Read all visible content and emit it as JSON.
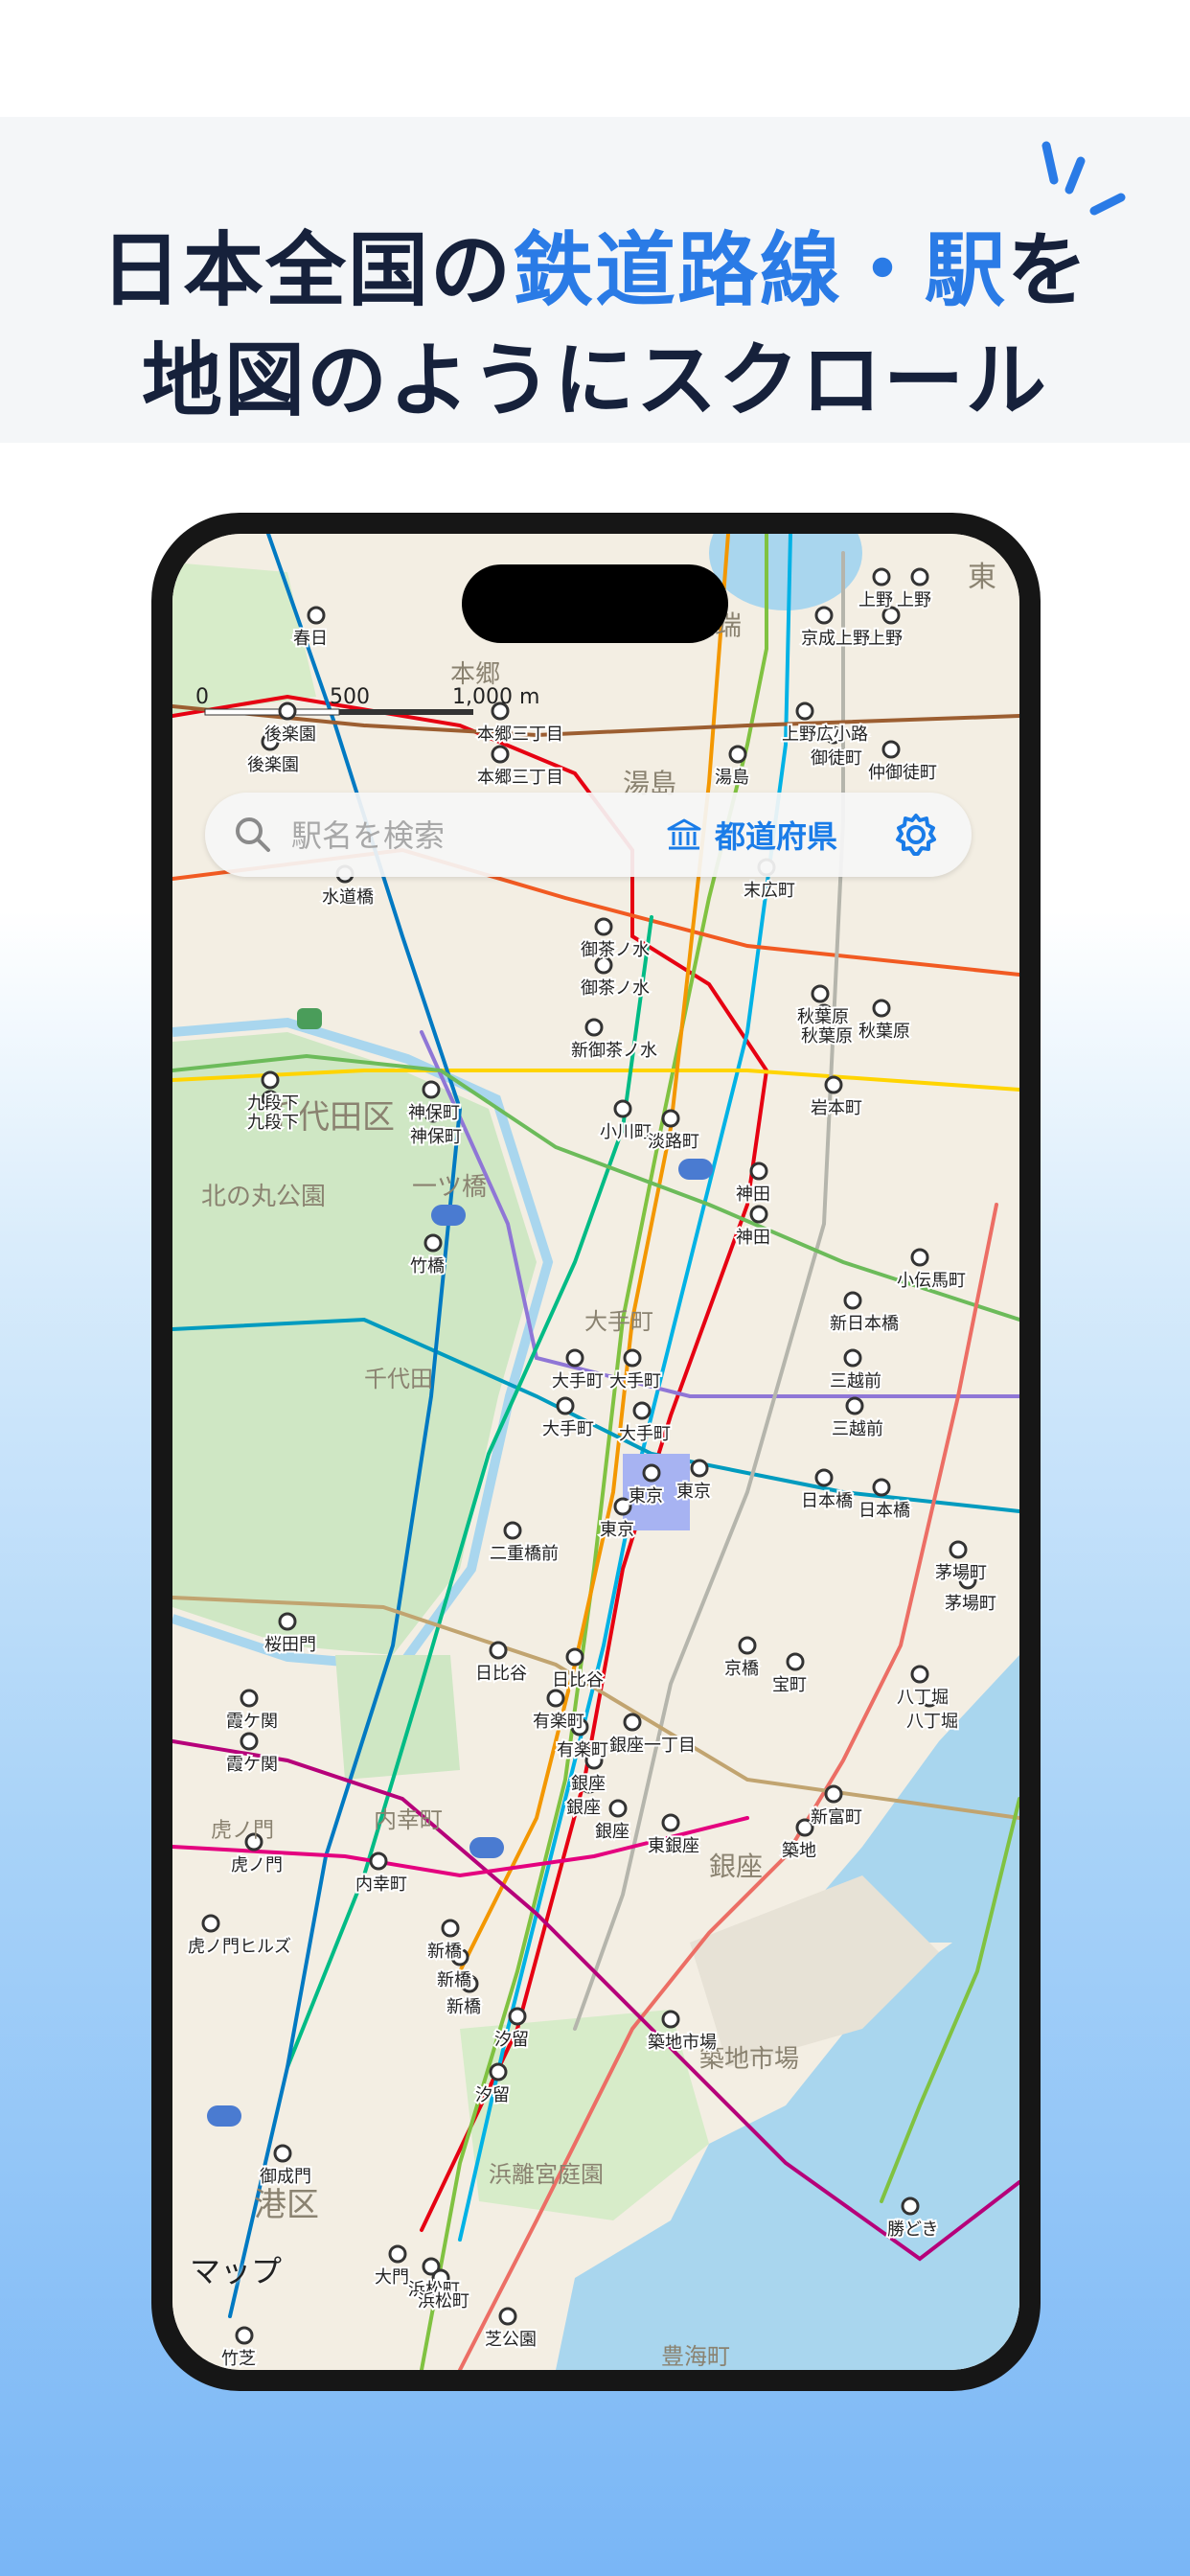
{
  "headline": {
    "line1_prefix": "日本全国の",
    "line1_accent": "鉄道路線・駅",
    "line1_suffix": "を",
    "line2": "地図のようにスクロール"
  },
  "search": {
    "placeholder": "駅名を検索"
  },
  "prefecture_button": {
    "label": "都道府県"
  },
  "map": {
    "attribution": "マップ",
    "scale": {
      "zero": "0",
      "mid": "500",
      "end": "1,000 m"
    },
    "areas": [
      "千代田区",
      "北の丸公園",
      "一ツ橋",
      "千代田",
      "内幸町",
      "銀座",
      "築地市場",
      "浜離宮庭園",
      "港区",
      "本郷",
      "湯島",
      "池之端",
      "大手町",
      "虎ノ門",
      "豊海町",
      "東"
    ],
    "stations": [
      "上野",
      "上野",
      "上野",
      "京成上野",
      "上野広小路",
      "御徒町",
      "仲御徒町",
      "春日",
      "後楽園",
      "後楽園",
      "本郷三丁目",
      "本郷三丁目",
      "湯島",
      "末広町",
      "水道橋",
      "御茶ノ水",
      "御茶ノ水",
      "新御茶ノ水",
      "秋葉原",
      "秋葉原",
      "秋葉原",
      "岩本町",
      "九段下",
      "九段下",
      "神保町",
      "神保町",
      "小川町",
      "淡路町",
      "神田",
      "神田",
      "竹橋",
      "小伝馬町",
      "新日本橋",
      "三越前",
      "三越前",
      "大手町",
      "大手町",
      "大手町",
      "大手町",
      "東京",
      "東京",
      "東京",
      "二重橋前",
      "日本橋",
      "日本橋",
      "茅場町",
      "茅場町",
      "桜田門",
      "日比谷",
      "日比谷",
      "有楽町",
      "有楽町",
      "銀座一丁目",
      "京橋",
      "宝町",
      "八丁堀",
      "八丁堀",
      "霞ケ関",
      "霞ケ関",
      "銀座",
      "銀座",
      "銀座",
      "新富町",
      "東銀座",
      "築地",
      "虎ノ門",
      "内幸町",
      "虎ノ門ヒルズ",
      "新橋",
      "新橋",
      "新橋",
      "汐留",
      "汐留",
      "築地市場",
      "御成門",
      "勝どき",
      "大門",
      "浜松町",
      "浜松町",
      "芝公園",
      "竹芝"
    ]
  },
  "colors": {
    "accent": "#2a7be6",
    "headline": "#16213b",
    "button_blue": "#1a7ce8"
  }
}
